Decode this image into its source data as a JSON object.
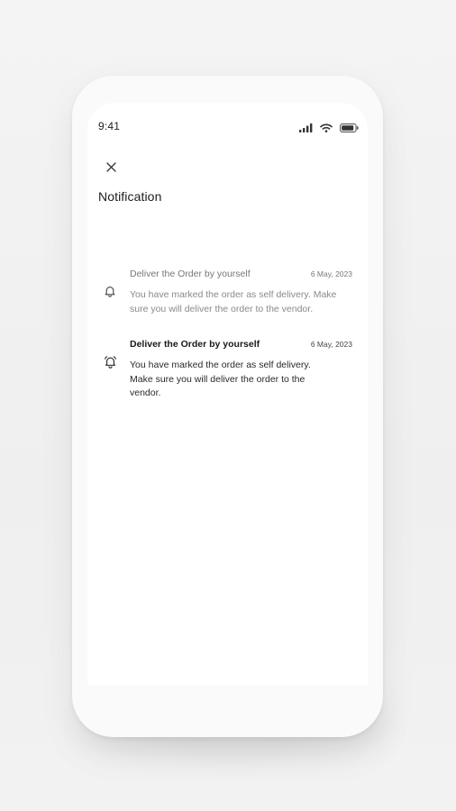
{
  "status_bar": {
    "time": "9:41",
    "icons": [
      "cellular-signal-icon",
      "wifi-icon",
      "battery-icon"
    ]
  },
  "header": {
    "close_icon": "close-icon",
    "title": "Notification"
  },
  "notifications": [
    {
      "title": "Deliver the Order by yourself",
      "date": "6 May, 2023",
      "body": "You have marked the order as self delivery. Make sure you will deliver the order to the vendor.",
      "read": true,
      "icon": "bell-icon"
    },
    {
      "title": "Deliver the Order by yourself",
      "date": "6 May, 2023",
      "body": "You have marked the order as self delivery. Make sure you will deliver the order to the vendor.",
      "read": false,
      "icon": "bell-ringing-icon"
    }
  ],
  "colors": {
    "background": "#f1f1f1",
    "screen": "#ffffff",
    "text_primary": "#1a1a1a",
    "text_muted": "#8a8a8a"
  }
}
